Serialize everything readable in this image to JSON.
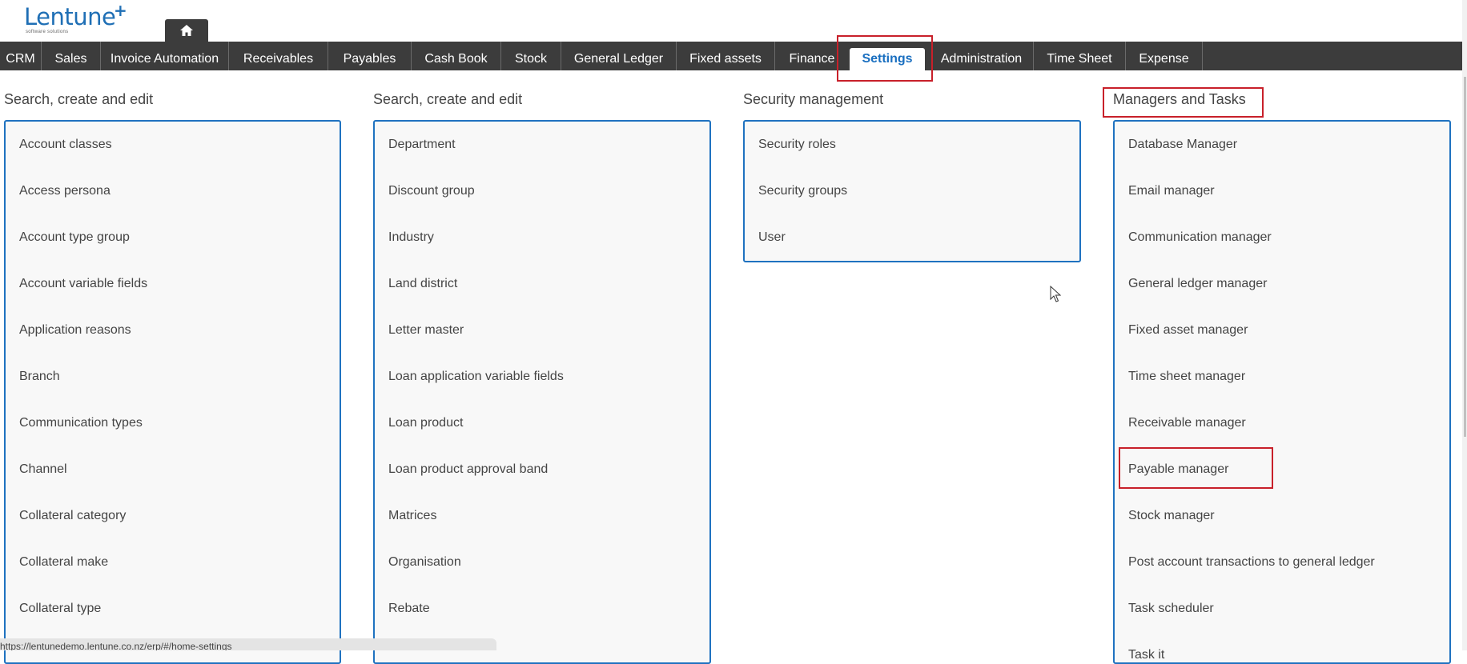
{
  "brand": {
    "name": "Lentune",
    "plus": "+",
    "tagline": "software solutions"
  },
  "nav": {
    "items": [
      {
        "label": "CRM"
      },
      {
        "label": "Sales"
      },
      {
        "label": "Invoice Automation"
      },
      {
        "label": "Receivables"
      },
      {
        "label": "Payables"
      },
      {
        "label": "Cash Book"
      },
      {
        "label": "Stock"
      },
      {
        "label": "General Ledger"
      },
      {
        "label": "Fixed assets"
      },
      {
        "label": "Finance"
      },
      {
        "label": "Settings",
        "active": true
      },
      {
        "label": "Administration"
      },
      {
        "label": "Time Sheet"
      },
      {
        "label": "Expense"
      }
    ]
  },
  "columns": [
    {
      "title": "Search, create and edit",
      "items": [
        "Account classes",
        "Access persona",
        "Account type group",
        "Account variable fields",
        "Application reasons",
        "Branch",
        "Communication types",
        "Channel",
        "Collateral category",
        "Collateral make",
        "Collateral type"
      ]
    },
    {
      "title": "Search, create and edit",
      "items": [
        "Department",
        "Discount group",
        "Industry",
        "Land district",
        "Letter master",
        "Loan application variable fields",
        "Loan product",
        "Loan product approval band",
        "Matrices",
        "Organisation",
        "Rebate"
      ]
    },
    {
      "title": "Security management",
      "items": [
        "Security roles",
        "Security groups",
        "User"
      ]
    },
    {
      "title": "Managers and Tasks",
      "items": [
        "Database Manager",
        "Email manager",
        "Communication manager",
        "General ledger manager",
        "Fixed asset manager",
        "Time sheet manager",
        "Receivable manager",
        "Payable manager",
        "Stock manager",
        "Post account transactions to general ledger",
        "Task scheduler",
        "Task it"
      ]
    }
  ],
  "status": {
    "url": "https://lentunedemo.lentune.co.nz/erp/#/home-settings"
  },
  "colors": {
    "navbar": "#3c3c3c",
    "accent": "#1f72c0",
    "highlight": "#c8202a"
  }
}
